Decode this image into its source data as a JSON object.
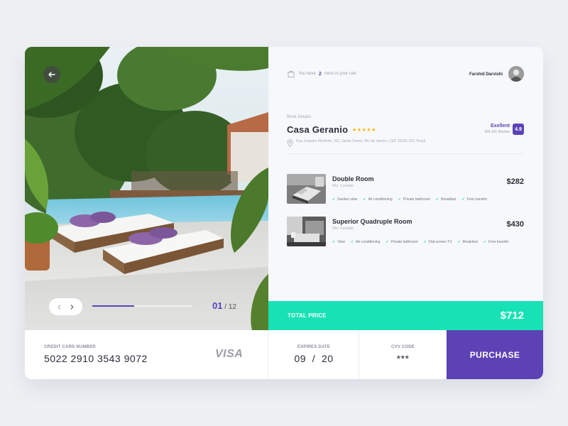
{
  "gallery": {
    "current": "01",
    "separator": "/",
    "total": "12",
    "progress_fraction": 0.42
  },
  "cart": {
    "prefix": "You have",
    "count": "2",
    "suffix": "room in your cart"
  },
  "user": {
    "name": "Farshid Darvishi"
  },
  "booking": {
    "label": "Book Details:",
    "hotel_name": "Casa Geranio",
    "stars": "★★★★★",
    "address": "Rua Joaquim Murtinho, 361, Santa Teresa, Rio de Janeiro, CEP 20241-320, Brazil",
    "rating_label": "Exellent",
    "reviews": "304,101 Review",
    "score": "4.9"
  },
  "rooms": [
    {
      "name": "Double Room",
      "fits": "Fits: 2 people",
      "price": "$282",
      "amenities": [
        "Garden view",
        "Air conditioning",
        "Private bathroom",
        "Breakfast",
        "Free transfer"
      ]
    },
    {
      "name": "Superior Quadruple Room",
      "fits": "Fits: 4 people",
      "price": "$430",
      "amenities": [
        "View",
        "Air conditioning",
        "Private bathroom",
        "Flat-screen TV",
        "Breakfast",
        "Free transfer"
      ]
    }
  ],
  "total": {
    "label": "TOTAL PRICE",
    "value": "$712"
  },
  "payment": {
    "card_label": "CREDIT CARD NUMBER",
    "card_number": "5022 2910 3543 9072",
    "card_brand": "VISA",
    "expires_label": "EXPIRES DATE",
    "expires_value": "09  /  20",
    "cvv_label": "CVV CODE",
    "cvv_value": "***",
    "purchase_label": "PURCHASE"
  },
  "colors": {
    "accent": "#5b43b8",
    "teal": "#17e2b5",
    "star": "#f5b800",
    "background": "#eef0f4"
  },
  "icons": [
    "arrow-left-icon",
    "chevron-left-icon",
    "chevron-right-icon",
    "cart-icon",
    "location-pin-icon",
    "check-icon"
  ]
}
